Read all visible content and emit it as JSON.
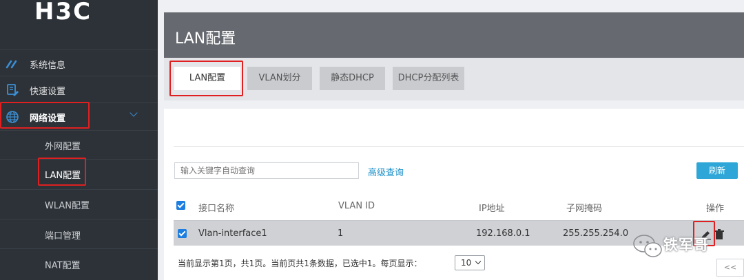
{
  "brand": {
    "logo_text": "H3C"
  },
  "sidebar": {
    "items": [
      {
        "label": "系统信息",
        "icon": "gauge-icon"
      },
      {
        "label": "快速设置",
        "icon": "wizard-icon"
      },
      {
        "label": "网络设置",
        "icon": "globe-icon",
        "expanded": true
      }
    ],
    "sub_items": [
      {
        "label": "外网配置"
      },
      {
        "label": "LAN配置",
        "selected": true
      },
      {
        "label": "WLAN配置"
      },
      {
        "label": "端口管理"
      },
      {
        "label": "NAT配置"
      }
    ]
  },
  "page": {
    "title": "LAN配置"
  },
  "tabs": [
    {
      "label": "LAN配置",
      "active": true
    },
    {
      "label": "VLAN划分"
    },
    {
      "label": "静态DHCP"
    },
    {
      "label": "DHCP分配列表"
    }
  ],
  "toolbar": {
    "search_placeholder": "输入关键字自动查询",
    "advanced_query": "高级查询",
    "refresh": "刷新"
  },
  "table": {
    "columns": [
      "接口名称",
      "VLAN ID",
      "IP地址",
      "子网掩码",
      "操作"
    ],
    "rows": [
      {
        "checked": true,
        "name": "Vlan-interface1",
        "vlan_id": "1",
        "ip": "192.168.0.1",
        "mask": "255.255.254.0"
      }
    ],
    "header_checked": true
  },
  "footer": {
    "summary": "当前显示第1页，共1页。当前页共1条数据，已选中1。每页显示：",
    "page_size": "10",
    "prev": "<<"
  },
  "watermark": {
    "text": "铁军哥"
  },
  "colors": {
    "accent": "#2ea7d8",
    "highlight": "#e02020",
    "sidebar_bg": "#2d3238"
  }
}
